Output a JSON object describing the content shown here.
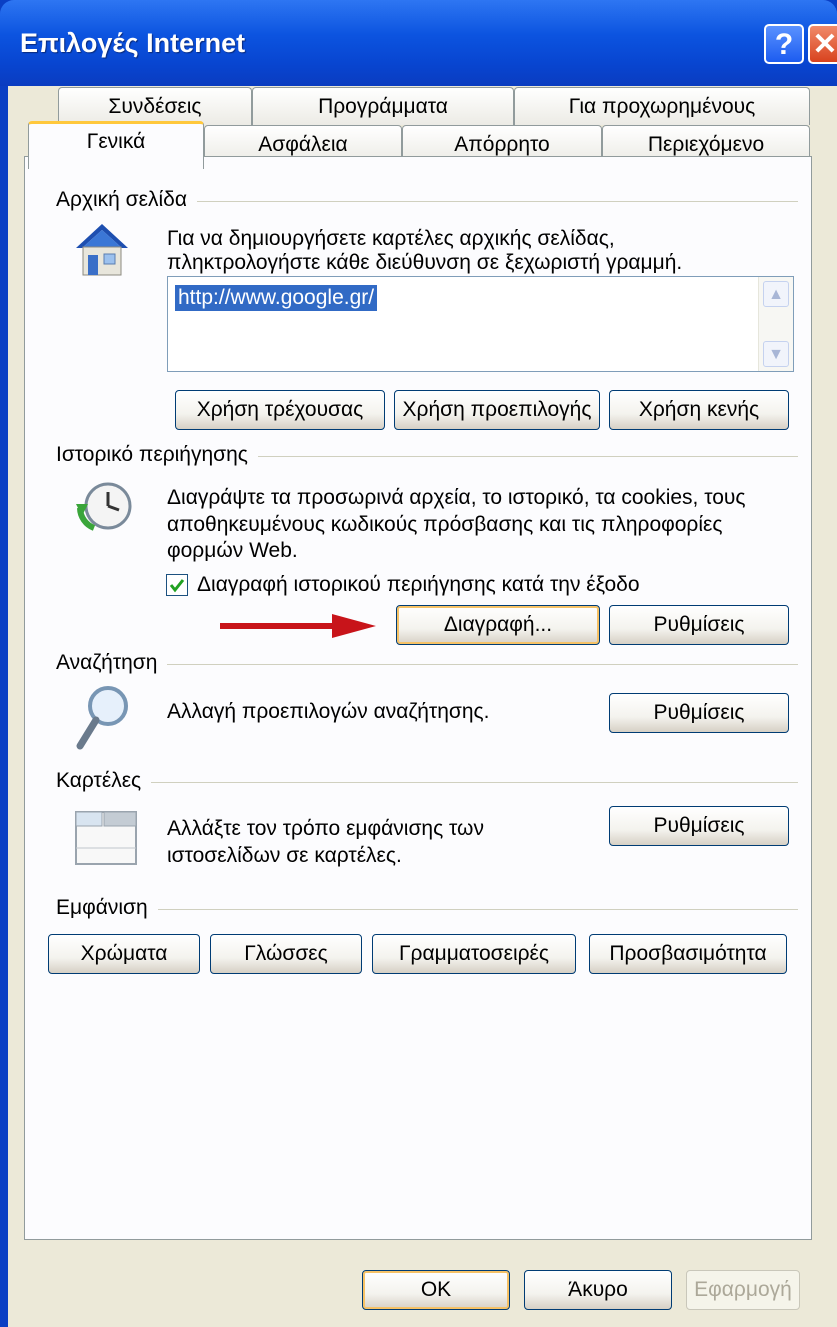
{
  "window": {
    "title": "Επιλογές Internet",
    "help_label": "?",
    "close_label": "✕"
  },
  "tabs": {
    "back_row": [
      "Συνδέσεις",
      "Προγράμματα",
      "Για προχωρημένους"
    ],
    "front_row": [
      "Γενικά",
      "Ασφάλεια",
      "Απόρρητο",
      "Περιεχόμενο"
    ],
    "active": "Γενικά"
  },
  "home": {
    "heading": "Αρχική σελίδα",
    "line1": "Για να δημιουργήσετε καρτέλες αρχικής σελίδας,",
    "line2": "πληκτρολογήστε κάθε διεύθυνση σε ξεχωριστή γραμμή.",
    "url": "http://www.google.gr/",
    "btn_current": "Χρήση τρέχουσας",
    "btn_default": "Χρήση προεπιλογής",
    "btn_blank": "Χρήση κενής"
  },
  "history": {
    "heading": "Ιστορικό περιήγησης",
    "line1": "Διαγράψτε τα προσωρινά αρχεία, το ιστορικό, τα cookies, τους",
    "line2": "αποθηκευμένους κωδικούς πρόσβασης και τις πληροφορίες",
    "line3": "φορμών Web.",
    "checkbox_label": "Διαγραφή ιστορικού περιήγησης κατά την έξοδο",
    "checkbox_checked": true,
    "btn_delete": "Διαγραφή...",
    "btn_settings": "Ρυθμίσεις"
  },
  "search": {
    "heading": "Αναζήτηση",
    "text": "Αλλαγή προεπιλογών αναζήτησης.",
    "btn_settings": "Ρυθμίσεις"
  },
  "tabs_section": {
    "heading": "Καρτέλες",
    "line1": "Αλλάξτε τον τρόπο εμφάνισης των",
    "line2": "ιστοσελίδων σε καρτέλες.",
    "btn_settings": "Ρυθμίσεις"
  },
  "appearance": {
    "heading": "Εμφάνιση",
    "btn_colors": "Χρώματα",
    "btn_languages": "Γλώσσες",
    "btn_fonts": "Γραμματοσειρές",
    "btn_accessibility": "Προσβασιμότητα"
  },
  "footer": {
    "ok": "OK",
    "cancel": "Άκυρο",
    "apply": "Εφαρμογή"
  },
  "colors": {
    "titlebar": "#0c54e0",
    "dialog_bg": "#ece9d8",
    "arrow": "#c8141a",
    "focus": "#f6c266"
  }
}
